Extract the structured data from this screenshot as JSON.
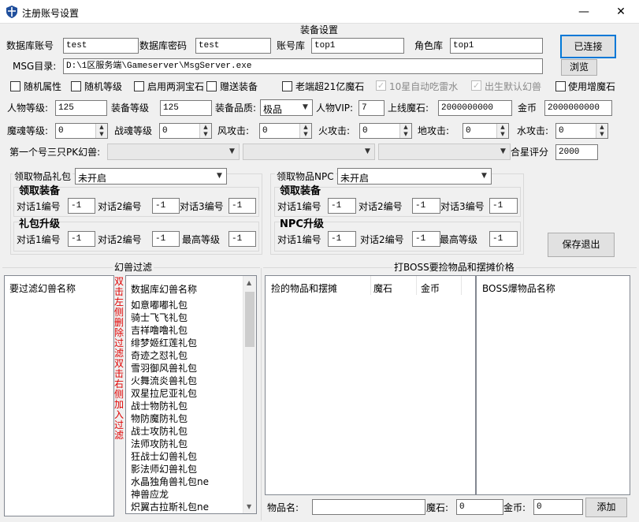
{
  "window": {
    "title": "注册账号设置",
    "icon": "shield-icon",
    "minimize": "—",
    "close": "✕"
  },
  "equip_section": {
    "title": "装备设置",
    "db_account_label": "数据库账号",
    "db_account_value": "test",
    "db_password_label": "数据库密码",
    "db_password_value": "test",
    "account_db_label": "账号库",
    "account_db_value": "top1",
    "role_db_label": "角色库",
    "role_db_value": "top1",
    "connect_button": "已连接",
    "msg_dir_label": "MSG目录:",
    "msg_dir_value": "D:\\1区服务端\\Gameserver\\MsgServer.exe",
    "browse_button": "浏览",
    "checkboxes": [
      {
        "label": "随机属性",
        "checked": false,
        "disabled": false
      },
      {
        "label": "随机等级",
        "checked": false,
        "disabled": false
      },
      {
        "label": "启用两洞宝石",
        "checked": false,
        "disabled": false
      },
      {
        "label": "赠送装备",
        "checked": false,
        "disabled": false
      },
      {
        "label": "老端超21亿魔石",
        "checked": false,
        "disabled": false
      },
      {
        "label": "10星自动吃雷水",
        "checked": true,
        "disabled": true
      },
      {
        "label": "出生默认幻兽",
        "checked": true,
        "disabled": true
      },
      {
        "label": "使用增魔石",
        "checked": false,
        "disabled": false
      }
    ],
    "char_level_label": "人物等级:",
    "char_level_value": "125",
    "equip_level_label": "装备等级",
    "equip_level_value": "125",
    "equip_quality_label": "装备品质:",
    "equip_quality_value": "极品",
    "vip_label": "人物VIP:",
    "vip_value": "7",
    "online_stone_label": "上线魔石:",
    "online_stone_value": "2000000000",
    "gold_label": "金币",
    "gold_value": "2000000000",
    "soul_level_label": "魔魂等级:",
    "soul_level_value": "0",
    "war_soul_label": "战魂等级",
    "war_soul_value": "0",
    "wind_attack_label": "风攻击:",
    "wind_attack_value": "0",
    "fire_attack_label": "火攻击:",
    "fire_attack_value": "0",
    "earth_attack_label": "地攻击:",
    "earth_attack_value": "0",
    "water_attack_label": "水攻击:",
    "water_attack_value": "0",
    "pk_pets_label": "第一个号三只PK幻兽:",
    "star_score_label": "合星评分",
    "star_score_value": "2000"
  },
  "gift_pack": {
    "label": "领取物品礼包",
    "value": "未开启",
    "equip_title": "领取装备",
    "d1_label": "对话1编号",
    "d1_value": "-1",
    "d2_label": "对话2编号",
    "d2_value": "-1",
    "d3_label": "对话3编号",
    "d3_value": "-1",
    "upgrade_title": "礼包升级",
    "u1_label": "对话1编号",
    "u1_value": "-1",
    "u2_label": "对话2编号",
    "u2_value": "-1",
    "max_label": "最高等级",
    "max_value": "-1"
  },
  "npc": {
    "label": "领取物品NPC",
    "value": "未开启",
    "equip_title": "领取装备",
    "d1_label": "对话1编号",
    "d1_value": "-1",
    "d2_label": "对话2编号",
    "d2_value": "-1",
    "d3_label": "对话3编号",
    "d3_value": "-1",
    "upgrade_title": "NPC升级",
    "u1_label": "对话1编号",
    "u1_value": "-1",
    "u2_label": "对话2编号",
    "u2_value": "-1",
    "max_label": "最高等级",
    "max_value": "-1"
  },
  "save_exit_button": "保存退出",
  "pet_filter": {
    "title": "幻兽过滤",
    "filter_header": "要过滤幻兽名称",
    "db_header": "数据库幻兽名称",
    "hint": "双击左侧删除过滤双击右侧加入过滤",
    "db_items": [
      "如意嘟嘟礼包",
      "骑士飞飞礼包",
      "吉祥噜噜礼包",
      "绯梦姬红莲礼包",
      "奇迹之怼礼包",
      "雪羽御风兽礼包",
      "火舞流炎兽礼包",
      "双星拉尼亚礼包",
      "战士物防礼包",
      "物防魔防礼包",
      "战士攻防礼包",
      "法师攻防礼包",
      "狂战士幻兽礼包",
      "影法师幻兽礼包",
      "水晶独角兽礼包ne",
      "神兽应龙",
      "炽翼古拉斯礼包ne"
    ]
  },
  "boss": {
    "title": "打BOSS要捡物品和摆摊价格",
    "col_item": "捡的物品和摆摊",
    "col_stone": "魔石",
    "col_gold": "金币",
    "drop_header": "BOSS爆物品名称",
    "item_name_label": "物品名:",
    "item_name_value": "",
    "stone_label": "魔石:",
    "stone_value": "0",
    "gold_label": "金币:",
    "gold_value": "0",
    "add_button": "添加"
  }
}
